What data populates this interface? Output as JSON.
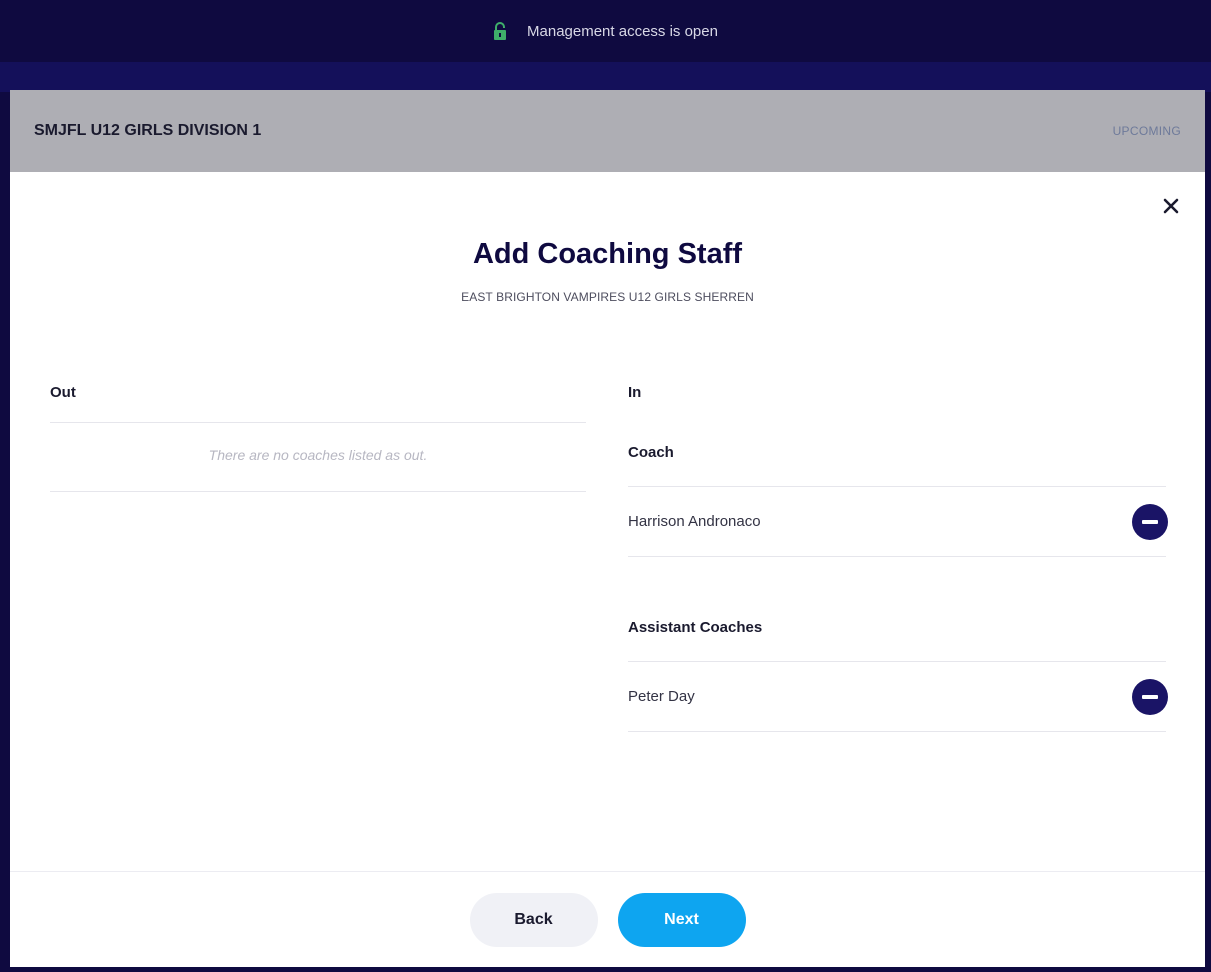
{
  "banner": {
    "text": "Management access is open",
    "icon": "lock-icon"
  },
  "league": {
    "title": "SMJFL U12 GIRLS DIVISION 1",
    "status": "UPCOMING"
  },
  "modal": {
    "title": "Add Coaching Staff",
    "subtitle": "EAST BRIGHTON VAMPIRES U12 GIRLS SHERREN",
    "out": {
      "heading": "Out",
      "empty_message": "There are no coaches listed as out."
    },
    "in": {
      "heading": "In",
      "coach_heading": "Coach",
      "coaches": [
        {
          "name": "Harrison Andronaco"
        }
      ],
      "assistant_heading": "Assistant Coaches",
      "assistants": [
        {
          "name": "Peter Day"
        }
      ]
    },
    "buttons": {
      "back": "Back",
      "next": "Next"
    }
  },
  "colors": {
    "navy": "#0f0a40",
    "accent_blue": "#0ea5f0",
    "remove_button": "#1a1466",
    "lock_green": "#3fae6a"
  }
}
